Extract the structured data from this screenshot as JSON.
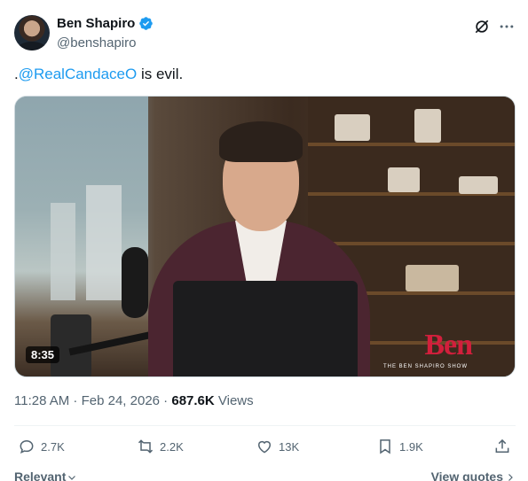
{
  "author": {
    "name": "Ben Shapiro",
    "handle": "@benshapiro",
    "verified": true
  },
  "tweet": {
    "prefix": ".",
    "mention": "@RealCandaceO",
    "text": " is evil."
  },
  "media": {
    "duration": "8:35",
    "logo_word": "Ben",
    "logo_sub": "THE  BEN  SHAPIRO  SHOW"
  },
  "meta": {
    "time": "11:28 AM",
    "separator": " · ",
    "date": "Feb 24, 2026",
    "separator2": " · ",
    "views_count": "687.6K",
    "views_label": " Views"
  },
  "actions": {
    "replies": "2.7K",
    "reposts": "2.2K",
    "likes": "13K",
    "bookmarks": "1.9K"
  },
  "footer": {
    "sort": "Relevant",
    "view_quotes": "View quotes"
  },
  "colors": {
    "accent": "#1d9bf0",
    "text": "#0f1419",
    "secondary": "#536471",
    "logo_red": "#d21f3c"
  },
  "icons": [
    "verified-badge-icon",
    "grok-icon",
    "more-icon",
    "reply-icon",
    "repost-icon",
    "like-icon",
    "bookmark-icon",
    "share-icon",
    "chevron-down-icon",
    "chevron-right-icon"
  ]
}
